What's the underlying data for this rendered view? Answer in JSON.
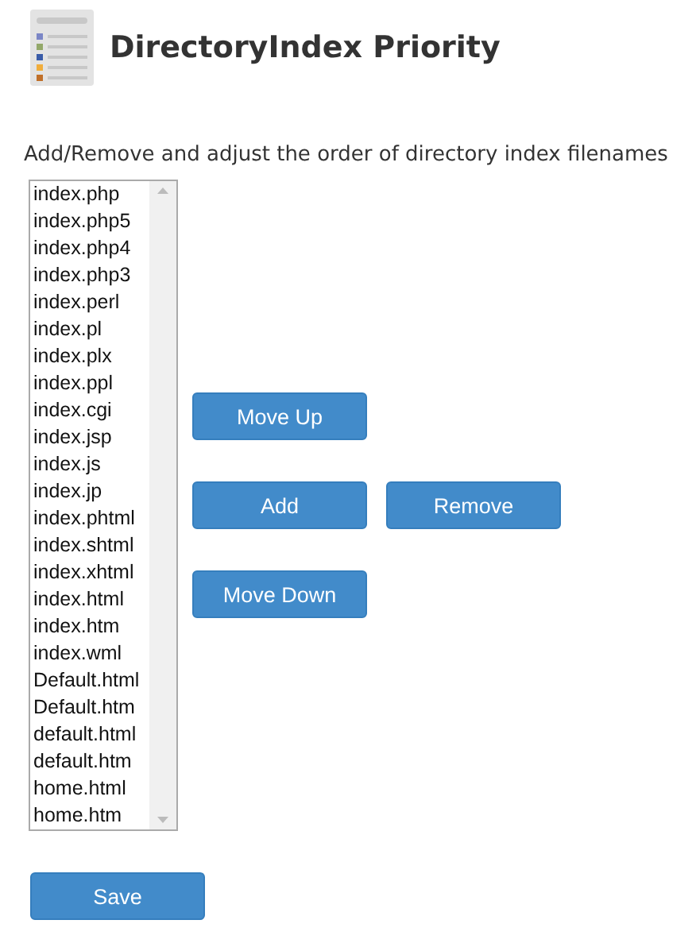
{
  "title": "DirectoryIndex Priority",
  "description": "Add/Remove and adjust the order of directory index filenames",
  "filenames": [
    "index.php",
    "index.php5",
    "index.php4",
    "index.php3",
    "index.perl",
    "index.pl",
    "index.plx",
    "index.ppl",
    "index.cgi",
    "index.jsp",
    "index.js",
    "index.jp",
    "index.phtml",
    "index.shtml",
    "index.xhtml",
    "index.html",
    "index.htm",
    "index.wml",
    "Default.html",
    "Default.htm",
    "default.html",
    "default.htm",
    "home.html",
    "home.htm"
  ],
  "move_up": "Move Up",
  "add": "Add",
  "remove": "Remove",
  "move_down": "Move Down",
  "save": "Save"
}
